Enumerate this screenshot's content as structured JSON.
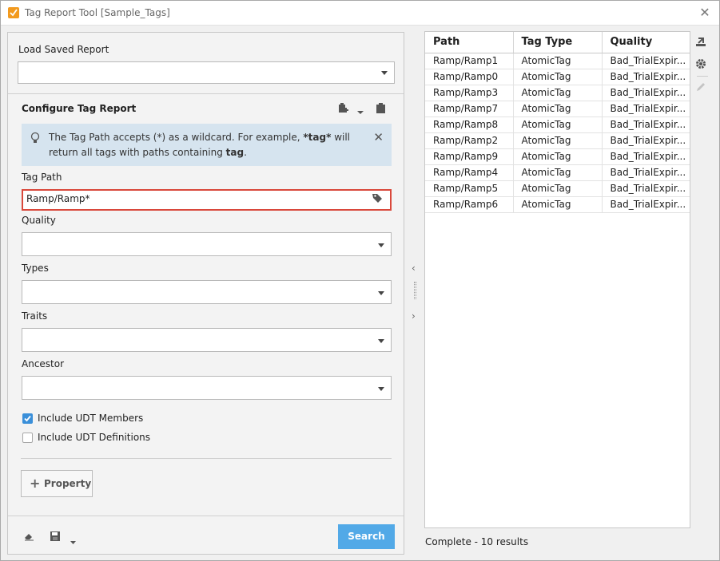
{
  "window": {
    "title": "Tag Report Tool [Sample_Tags]",
    "close_glyph": "✕",
    "app_icon": "ignition-app-icon"
  },
  "left": {
    "load_label": "Load Saved Report",
    "load_value": "",
    "configure_title": "Configure Tag Report",
    "info": {
      "text_1": "The Tag Path accepts (*) as a wildcard. For example, ",
      "text_bold_1": "*tag*",
      "text_2": " will return all tags with paths containing ",
      "text_bold_2": "tag",
      "text_3": ".",
      "close_glyph": "✕"
    },
    "tag_path_label": "Tag Path",
    "tag_path_value": "Ramp/Ramp*",
    "quality_label": "Quality",
    "quality_value": "",
    "types_label": "Types",
    "types_value": "",
    "traits_label": "Traits",
    "traits_value": "",
    "ancestor_label": "Ancestor",
    "ancestor_value": "",
    "include_udt_members": {
      "label": "Include UDT Members",
      "checked": true
    },
    "include_udt_definitions": {
      "label": "Include UDT Definitions",
      "checked": false
    },
    "property_button": {
      "plus": "+",
      "label": "Property"
    },
    "search_button": "Search"
  },
  "results": {
    "columns": [
      "Path",
      "Tag Type",
      "Quality"
    ],
    "rows": [
      [
        "Ramp/Ramp1",
        "AtomicTag",
        "Bad_TrialExpir..."
      ],
      [
        "Ramp/Ramp0",
        "AtomicTag",
        "Bad_TrialExpir..."
      ],
      [
        "Ramp/Ramp3",
        "AtomicTag",
        "Bad_TrialExpir..."
      ],
      [
        "Ramp/Ramp7",
        "AtomicTag",
        "Bad_TrialExpir..."
      ],
      [
        "Ramp/Ramp8",
        "AtomicTag",
        "Bad_TrialExpir..."
      ],
      [
        "Ramp/Ramp2",
        "AtomicTag",
        "Bad_TrialExpir..."
      ],
      [
        "Ramp/Ramp9",
        "AtomicTag",
        "Bad_TrialExpir..."
      ],
      [
        "Ramp/Ramp4",
        "AtomicTag",
        "Bad_TrialExpir..."
      ],
      [
        "Ramp/Ramp5",
        "AtomicTag",
        "Bad_TrialExpir..."
      ],
      [
        "Ramp/Ramp6",
        "AtomicTag",
        "Bad_TrialExpir..."
      ]
    ],
    "status": "Complete - 10 results"
  },
  "splitter": {
    "collapse_glyph": "‹",
    "expand_glyph": "›"
  },
  "colors": {
    "accent": "#52a9e7",
    "highlight_border": "#d9483b",
    "info_bg": "#d6e4ef",
    "app_icon": "#f29a1e"
  }
}
